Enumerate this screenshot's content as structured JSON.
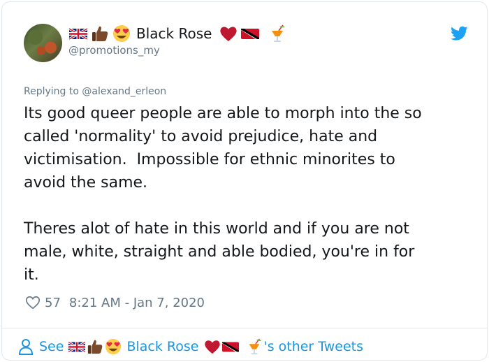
{
  "author": {
    "display_name": "Black Rose",
    "handle": "@promotions_my",
    "name_prefix_emoji": [
      "uk-flag-icon",
      "thumbs-up-icon",
      "heart-eyes-icon"
    ],
    "name_suffix_emoji": [
      "red-heart-icon",
      "trinidad-flag-icon",
      "tropical-drink-icon"
    ]
  },
  "reply": {
    "text": "Replying to @alexand_erleon"
  },
  "tweet": {
    "text": "Its good queer people are able to morph into the so\ncalled 'normality' to avoid prejudice, hate and\nvictimisation.  Impossible for ethnic minorites to\navoid the same.\n\nTheres alot of hate in this world and if you are not\nmale, white, straight and able bodied, you're in for\nit.",
    "likes": "57",
    "timestamp": "8:21 AM - Jan 7, 2020"
  },
  "footer": {
    "see_label": "See",
    "display_name": "Black Rose",
    "suffix_label": "'s other Tweets"
  },
  "colors": {
    "link": "#1b95e0",
    "muted": "#657786",
    "text": "#14171a",
    "twitter_blue": "#1da1f2"
  }
}
